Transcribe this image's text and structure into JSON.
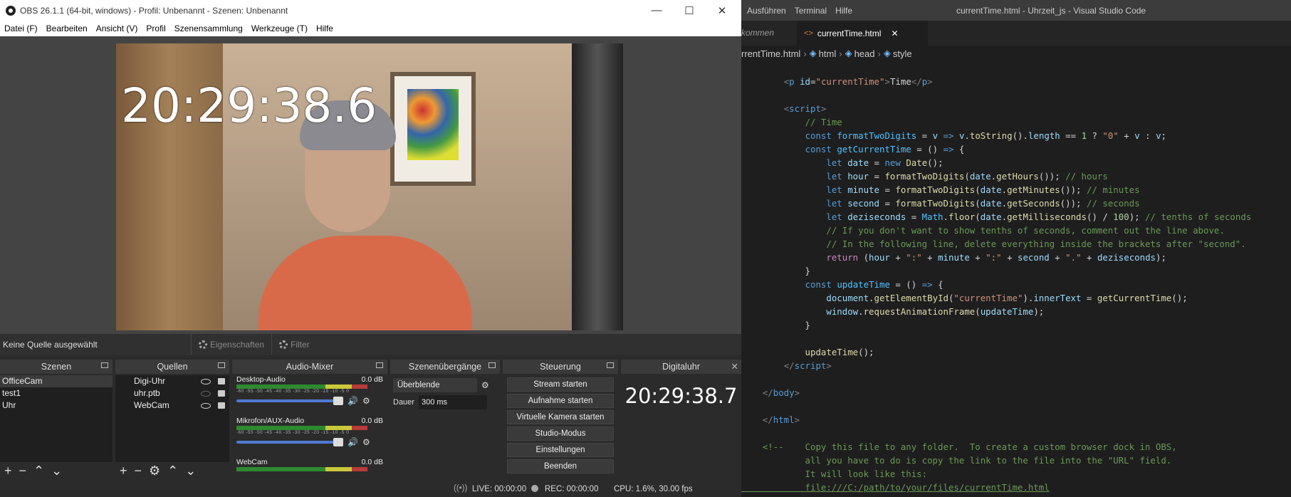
{
  "obs": {
    "title": "OBS 26.1.1 (64-bit, windows) - Profil: Unbenannt - Szenen: Unbenannt",
    "menu": [
      "Datei (F)",
      "Bearbeiten",
      "Ansicht (V)",
      "Profil",
      "Szenensammlung",
      "Werkzeuge (T)",
      "Hilfe"
    ],
    "overlay_clock": "20:29:38.6",
    "source_bar": {
      "no_source": "Keine Quelle ausgewählt",
      "properties": "Eigenschaften",
      "filter": "Filter"
    },
    "scenes": {
      "title": "Szenen",
      "items": [
        "OfficeCam",
        "test1",
        "Uhr"
      ]
    },
    "sources": {
      "title": "Quellen",
      "items": [
        "Digi-Uhr",
        "uhr.ptb",
        "WebCam"
      ]
    },
    "mixer": {
      "title": "Audio-Mixer",
      "channels": [
        {
          "name": "Desktop-Audio",
          "level": "0.0 dB"
        },
        {
          "name": "Mikrofon/AUX-Audio",
          "level": "0.0 dB"
        },
        {
          "name": "WebCam",
          "level": "0.0 dB"
        }
      ],
      "scale": "-60 -55 -50 -45 -40 -35 -30 -25 -20 -15 -10 -5 0"
    },
    "transitions": {
      "title": "Szenenübergänge",
      "selected": "Überblende",
      "duration_label": "Dauer",
      "duration": "300 ms"
    },
    "controls": {
      "title": "Steuerung",
      "buttons": [
        "Stream starten",
        "Aufnahme starten",
        "Virtuelle Kamera starten",
        "Studio-Modus",
        "Einstellungen",
        "Beenden"
      ]
    },
    "digi": {
      "title": "Digitaluhr",
      "time": "20:29:38.7"
    },
    "status": {
      "live": "LIVE: 00:00:00",
      "rec": "REC: 00:00:00",
      "cpu": "CPU: 1.6%, 30.00 fps"
    }
  },
  "vscode": {
    "menu": [
      "Ausführen",
      "Terminal",
      "Hilfe"
    ],
    "title": "currentTime.html - Uhrzeit_js - Visual Studio Code",
    "tab_prev": "kommen",
    "tab_active": "currentTime.html",
    "breadcrumb": [
      "rrentTime.html",
      "html",
      "head",
      "style"
    ]
  },
  "colors": {
    "obs_bg": "#2b2b2b",
    "vscode_bg": "#1e1e1e",
    "accent": "#4f7ad1"
  }
}
